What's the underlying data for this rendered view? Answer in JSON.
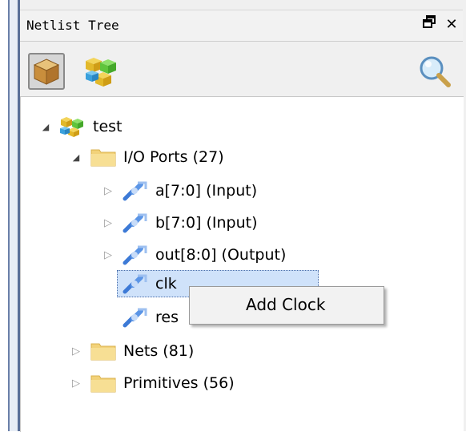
{
  "panel": {
    "title": "Netlist Tree",
    "float_icon": "restore-icon",
    "close_symbol": "✕"
  },
  "toolbar": {
    "buttons": [
      {
        "name": "cube-view-icon",
        "active": true
      },
      {
        "name": "hierarchy-cubes-icon",
        "active": false
      },
      {
        "name": "search-icon",
        "active": false
      }
    ]
  },
  "tree": {
    "root": "test",
    "io_ports": "I/O Ports (27)",
    "ports": [
      "a[7:0] (Input)",
      "b[7:0] (Input)",
      "out[8:0] (Output)",
      "clk (Input)",
      "reset (Input)"
    ],
    "visible_port_labels": [
      "clk",
      "res"
    ],
    "nets": "Nets (81)",
    "primitives": "Primitives (56)"
  },
  "context_menu": {
    "items": [
      "Add Clock"
    ]
  },
  "colors": {
    "selection": "#cfe2fa",
    "folder": "#f2d27a",
    "port_icon": "#3d7ad6"
  }
}
